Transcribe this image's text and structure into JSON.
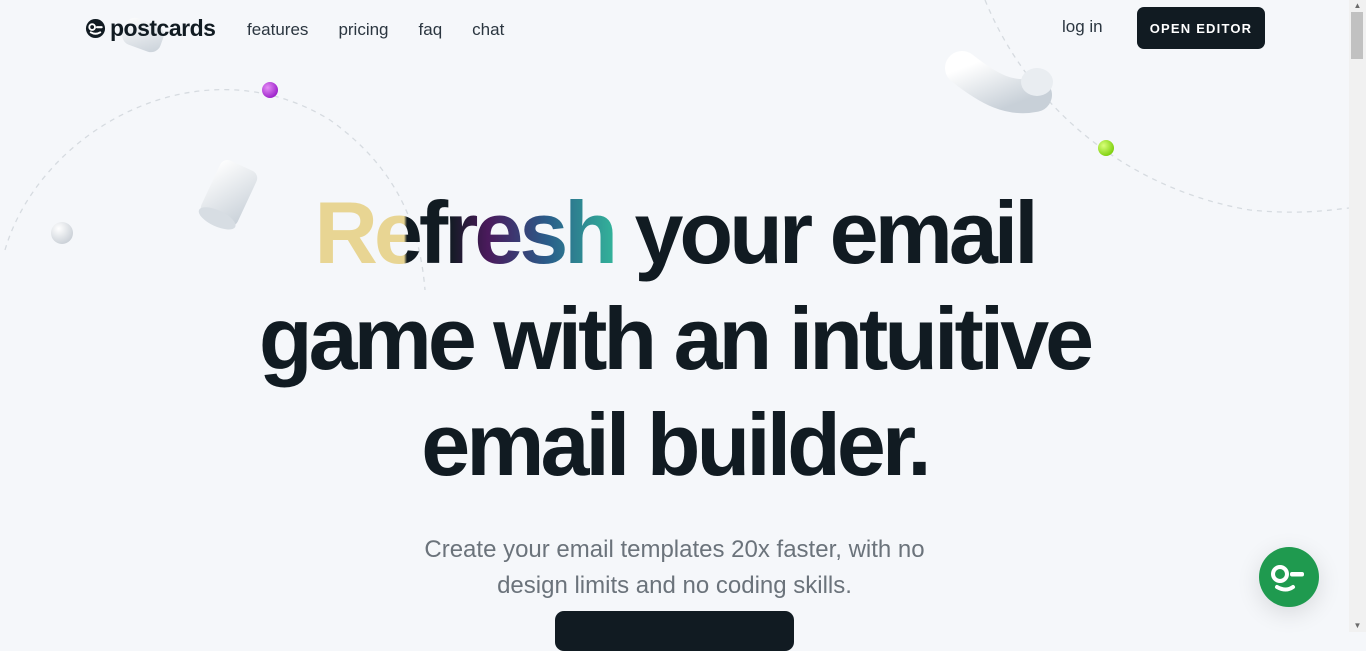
{
  "brand": {
    "name": "postcards",
    "logo_icon": "postcards-logo-icon"
  },
  "nav": {
    "items": [
      "features",
      "pricing",
      "faq",
      "chat"
    ]
  },
  "header": {
    "login_label": "log in",
    "open_editor_label": "OPEN EDITOR"
  },
  "hero": {
    "accent_word": "Refresh",
    "line1_rest": " your email",
    "line2": "game with an intuitive",
    "line3": "email builder.",
    "subtitle_line1": "Create your email templates 20x faster, with no",
    "subtitle_line2": "design limits and no coding skills."
  },
  "chat_widget": {
    "icon": "chat-support-icon",
    "color": "#1f9a4f"
  },
  "colors": {
    "dark": "#111b22",
    "accent_gold": "#e8d593",
    "accent_teal": "#33b39a",
    "background": "#f5f7fa"
  }
}
